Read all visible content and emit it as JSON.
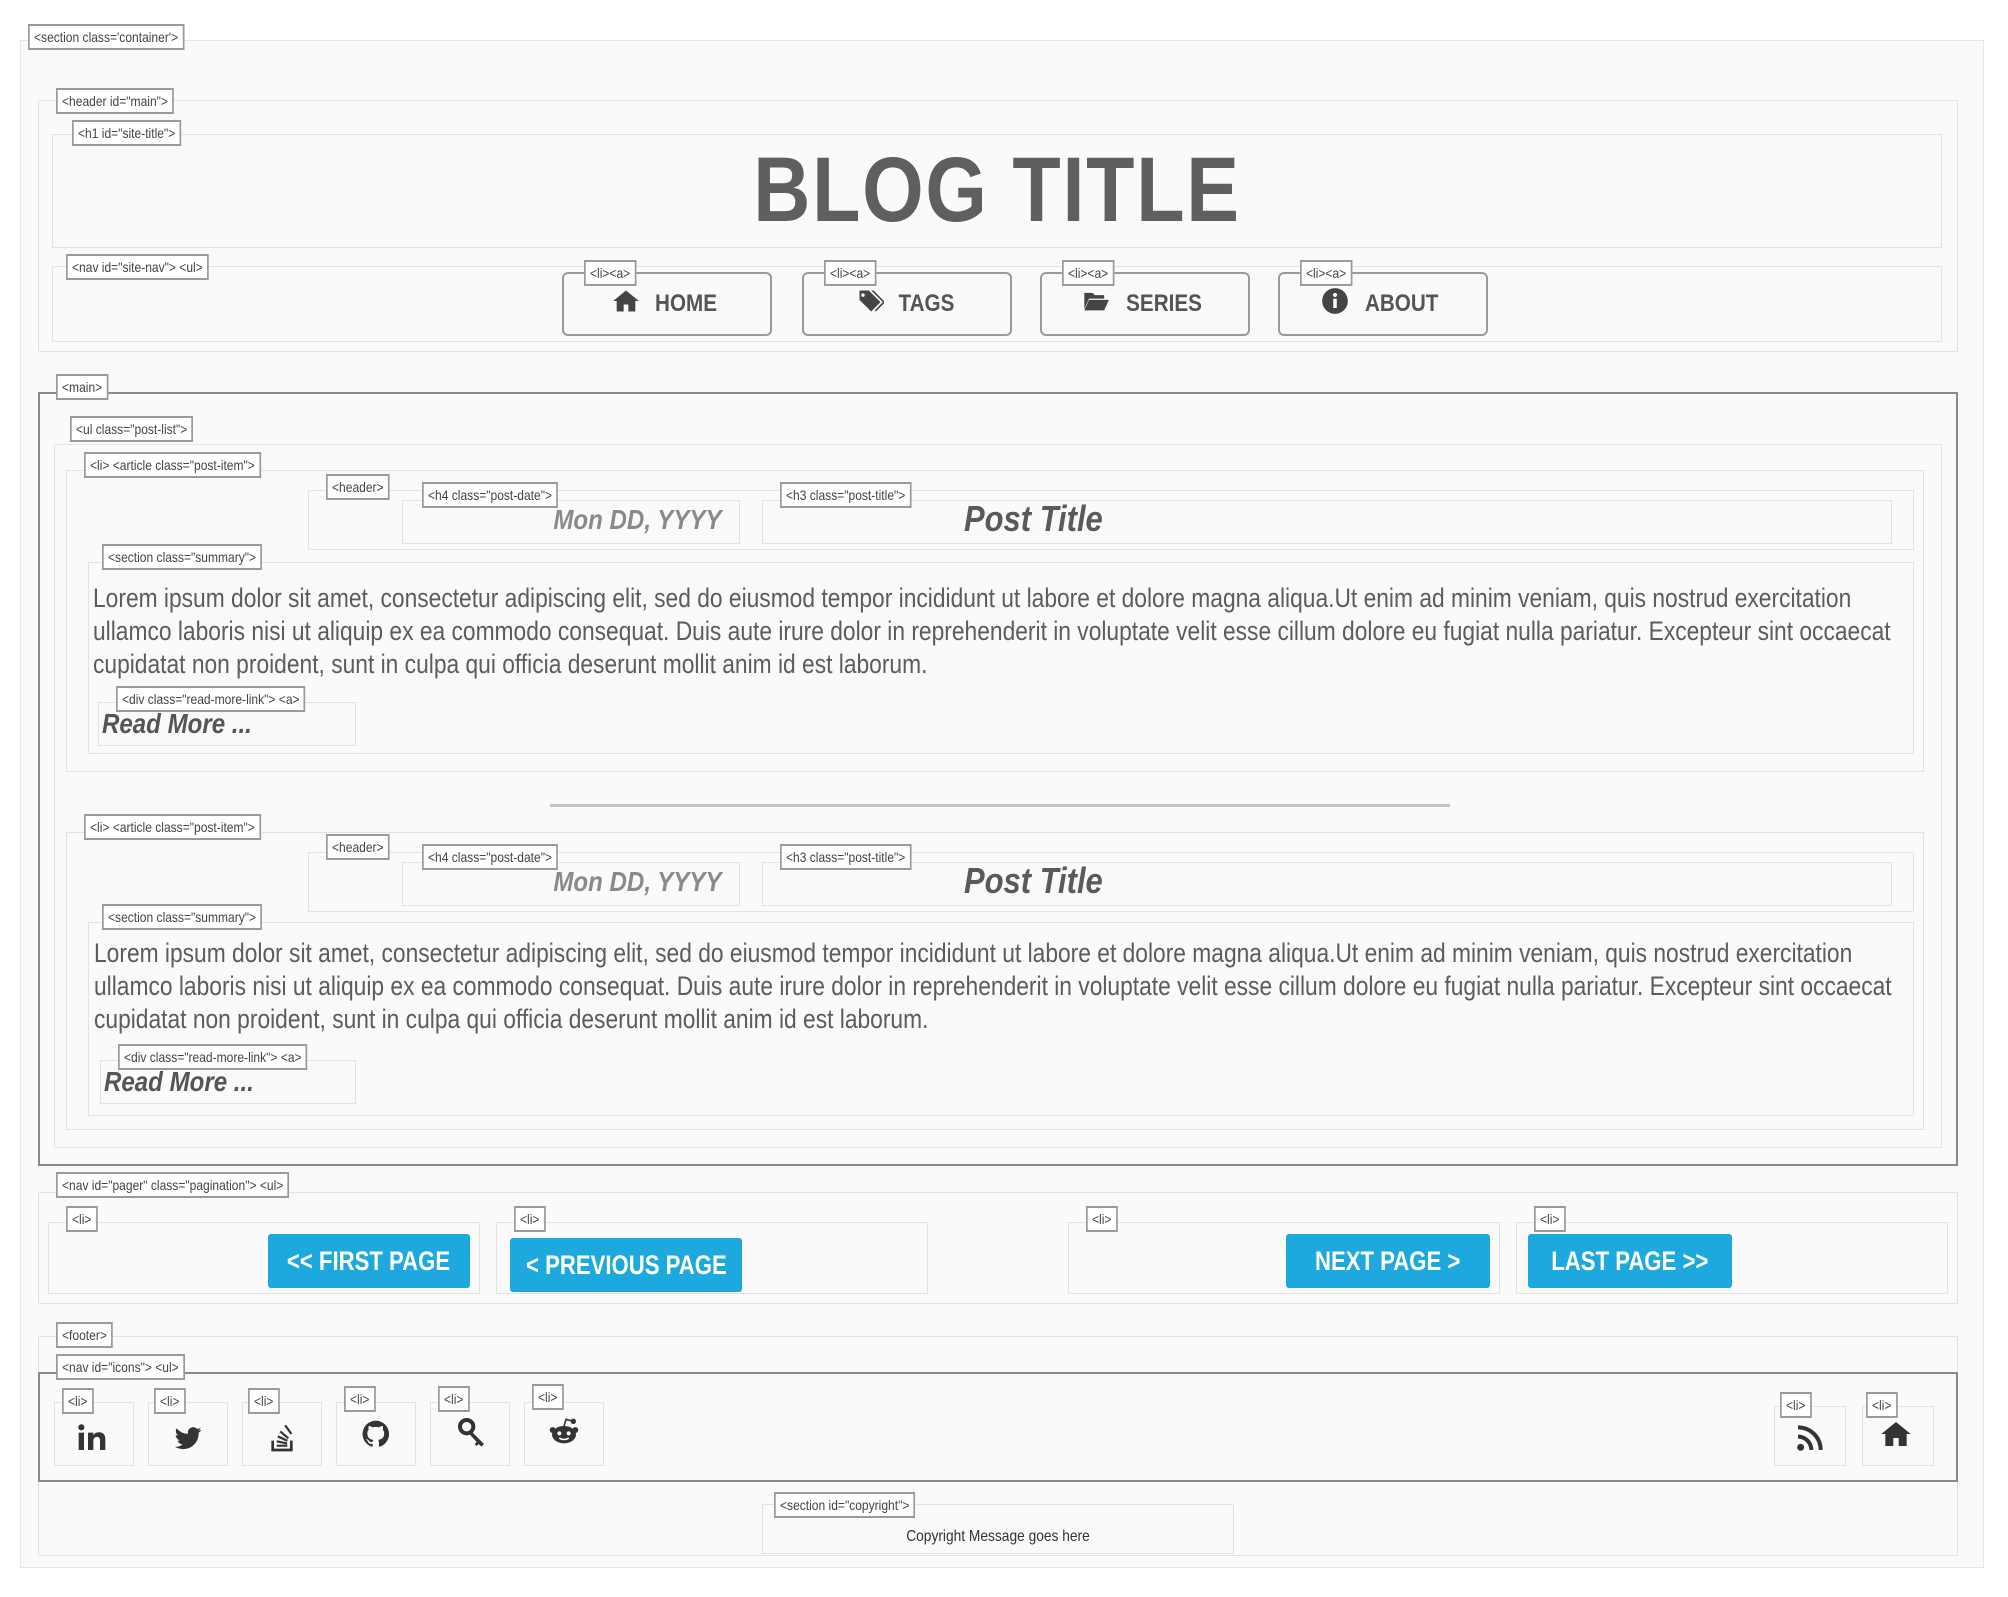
{
  "tags": {
    "container": "<section class='container'>",
    "header_main": "<header id=\"main\">",
    "h1_site_title": "<h1 id=\"site-title\">",
    "nav_site": "<nav id=\"site-nav\"> <ul>",
    "li_a": "<li><a>",
    "main": "<main>",
    "ul_post_list": "<ul class=\"post-list\">",
    "li_article": "<li> <article class=\"post-item\">",
    "header": "<header>",
    "h4_post_date": "<h4 class=\"post-date\">",
    "h3_post_title": "<h3 class=\"post-title\">",
    "section_summary": "<section class=\"summary\">",
    "div_read_more": "<div class=\"read-more-link\"> <a>",
    "nav_pager": "<nav id=\"pager\" class=\"pagination\"> <ul>",
    "li": "<li>",
    "footer": "<footer>",
    "nav_icons": "<nav id=\"icons\"> <ul>",
    "section_copyright": "<section id=\"copyright\">"
  },
  "site_title": "BLOG TITLE",
  "nav": [
    {
      "label": "HOME",
      "icon": "home-icon"
    },
    {
      "label": "TAGS",
      "icon": "tags-icon"
    },
    {
      "label": "SERIES",
      "icon": "folder-open-icon"
    },
    {
      "label": "ABOUT",
      "icon": "info-icon"
    }
  ],
  "posts": [
    {
      "date": "Mon DD, YYYY",
      "title": "Post Title",
      "summary": "Lorem ipsum dolor sit amet, consectetur adipiscing elit, sed do eiusmod tempor incididunt ut labore et dolore magna aliqua.Ut enim ad minim veniam, quis nostrud exercitation ullamco laboris nisi ut aliquip ex ea commodo consequat. Duis aute irure dolor in reprehenderit in voluptate velit esse cillum dolore eu fugiat nulla pariatur. Excepteur sint occaecat cupidatat non proident, sunt in culpa qui officia deserunt mollit anim id est laborum.",
      "read_more": "Read More ..."
    },
    {
      "date": "Mon DD, YYYY",
      "title": "Post Title",
      "summary": "Lorem ipsum dolor sit amet, consectetur adipiscing elit, sed do eiusmod tempor incididunt ut labore et dolore magna aliqua.Ut enim ad minim veniam, quis nostrud exercitation ullamco laboris nisi ut aliquip ex ea commodo consequat. Duis aute irure dolor in reprehenderit in voluptate velit esse cillum dolore eu fugiat nulla pariatur. Excepteur sint occaecat cupidatat non proident, sunt in culpa qui officia deserunt mollit anim id est laborum.",
      "read_more": "Read More ..."
    }
  ],
  "pager": {
    "first": "<< FIRST PAGE",
    "previous": "< PREVIOUS PAGE",
    "next": "NEXT PAGE >",
    "last": "LAST PAGE >>",
    "accent": "#1da9de"
  },
  "footer_icons": [
    "linkedin-icon",
    "twitter-icon",
    "stackoverflow-icon",
    "github-icon",
    "key-icon",
    "reddit-icon",
    "rss-icon",
    "home-icon"
  ],
  "copyright": "Copyright Message goes here"
}
